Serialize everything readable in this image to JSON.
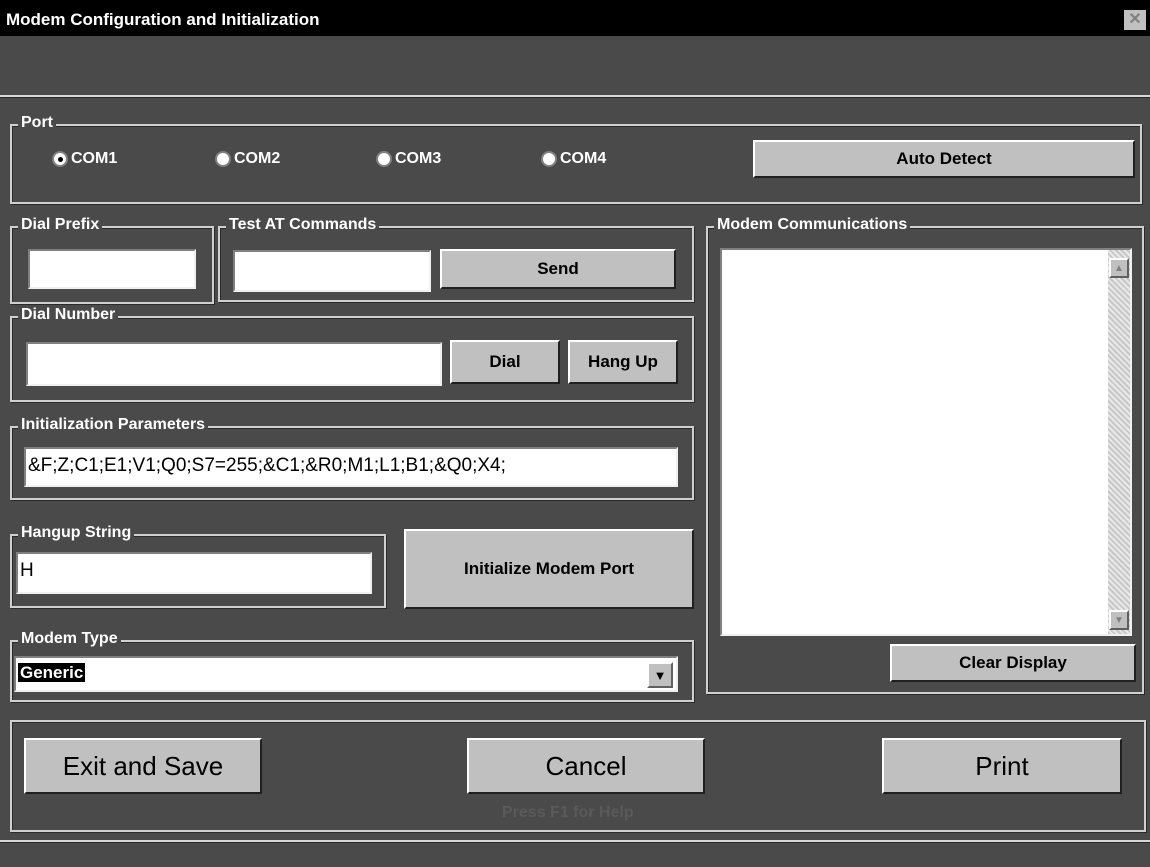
{
  "window": {
    "title": "Modem Configuration and Initialization",
    "close_glyph": "✕"
  },
  "port": {
    "legend": "Port",
    "options": [
      "COM1",
      "COM2",
      "COM3",
      "COM4"
    ],
    "selected": "COM1",
    "auto_detect_label": "Auto Detect"
  },
  "dial_prefix": {
    "legend": "Dial Prefix",
    "value": ""
  },
  "test_at": {
    "legend": "Test AT Commands",
    "value": "",
    "send_label": "Send"
  },
  "dial_number": {
    "legend": "Dial Number",
    "value": "",
    "dial_label": "Dial",
    "hangup_label": "Hang Up"
  },
  "init_params": {
    "legend": "Initialization Parameters",
    "value": "&F;Z;C1;E1;V1;Q0;S7=255;&C1;&R0;M1;L1;B1;&Q0;X4;"
  },
  "hangup_string": {
    "legend": "Hangup String",
    "value": "H"
  },
  "init_button_label": "Initialize Modem Port",
  "modem_type": {
    "legend": "Modem Type",
    "value": "Generic"
  },
  "communications": {
    "legend": "Modem Communications",
    "clear_label": "Clear Display"
  },
  "footer": {
    "exit_label": "Exit and Save",
    "cancel_label": "Cancel",
    "print_label": "Print",
    "help_text": "Press F1 for Help"
  },
  "icons": [
    "close-icon",
    "radio-icon",
    "dropdown-arrow-icon",
    "scroll-up-icon",
    "scroll-down-icon"
  ]
}
